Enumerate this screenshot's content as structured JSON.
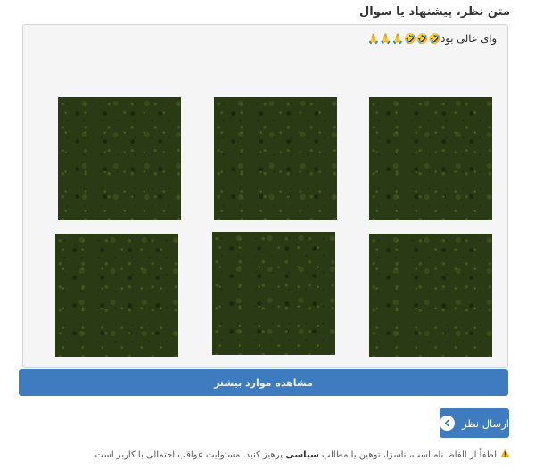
{
  "form": {
    "heading": "متن نظر، پیشنهاد یا سوال"
  },
  "comment": {
    "text": "وای عالی بود",
    "emojis": "🤣🤣🤣🙏🙏🙏",
    "images": [
      {
        "name": "camouflage-image-1"
      },
      {
        "name": "camouflage-image-2"
      },
      {
        "name": "camouflage-image-3"
      },
      {
        "name": "camouflage-image-4"
      },
      {
        "name": "camouflage-image-5"
      },
      {
        "name": "camouflage-image-6"
      }
    ]
  },
  "buttons": {
    "show_more": "مشاهده موارد بیشتر",
    "submit": "ارسال نظر",
    "submit_icon": "chevron-left-icon"
  },
  "notice": {
    "icon": "warning-icon",
    "part1": "لطفاً از الفاظ نامناسب، ناسزا، توهین یا مطالب",
    "highlight": "سیاسی",
    "part2": "پرهیز کنید. مسئولیت عواقب احتمالی با کاربر است."
  },
  "colors": {
    "primary": "#3f7bbf",
    "box_bg": "#f5f5f5",
    "box_border": "#c9d7e3",
    "warning": "#f0b400"
  }
}
